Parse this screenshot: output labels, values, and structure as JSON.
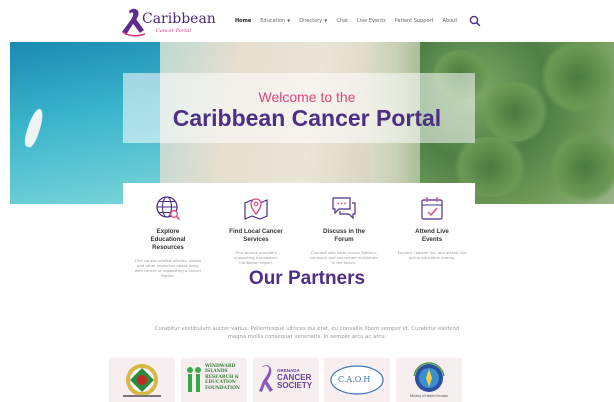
{
  "logo": {
    "title": "Caribbean",
    "subtitle": "Cancer Portal"
  },
  "nav": {
    "items": [
      {
        "label": "Home",
        "active": true,
        "dropdown": false
      },
      {
        "label": "Education",
        "active": false,
        "dropdown": true
      },
      {
        "label": "Directory",
        "active": false,
        "dropdown": true
      },
      {
        "label": "Chat",
        "active": false,
        "dropdown": false
      },
      {
        "label": "Live Events",
        "active": false,
        "dropdown": false
      },
      {
        "label": "Patient Support",
        "active": false,
        "dropdown": false
      },
      {
        "label": "About",
        "active": false,
        "dropdown": false
      }
    ],
    "search_icon": "search-icon"
  },
  "hero": {
    "welcome": "Welcome to the",
    "title": "Caribbean Cancer Portal"
  },
  "features": [
    {
      "icon": "globe-search-icon",
      "title": "Explore Educational Resources",
      "desc": "Find cancer-related articles, videos and other resources about living with cancer or supporting a cancer fighter."
    },
    {
      "icon": "map-pin-icon",
      "title": "Find Local Cancer Services",
      "desc": "Find service providers supporting the eastern Caribbean region."
    },
    {
      "icon": "chat-bubbles-icon",
      "title": "Discuss in the Forum",
      "desc": "Connect with local cancer fighters, survivors and concerned individuals in the forum."
    },
    {
      "icon": "calendar-check-icon",
      "title": "Attend Live Events",
      "desc": "Explore, register for, and attend live online education events."
    }
  ],
  "partners": {
    "title": "Our Partners",
    "text": "Curabitur vestibulum auctor varius. Pellentesque ultrices dui erat, eu convallis libero semper et. Curabitur eleifend magna mollis consequat venenatis. In semper arcu ac arcu.",
    "logos": [
      {
        "name": "partner-logo-1"
      },
      {
        "name": "windward-islands-research-foundation",
        "text": "WINDWARD ISLANDS RESEARCH & EDUCATION FOUNDATION"
      },
      {
        "name": "grenada-cancer-society",
        "text1": "GRENADA",
        "text2": "CANCER SOCIETY"
      },
      {
        "name": "caoh",
        "text": "C.A.O.H"
      },
      {
        "name": "ministry-of-health",
        "text": "Ministry of Health Grenada"
      }
    ]
  },
  "colors": {
    "brand_purple": "#4e2f86",
    "brand_pink": "#e0457f"
  }
}
